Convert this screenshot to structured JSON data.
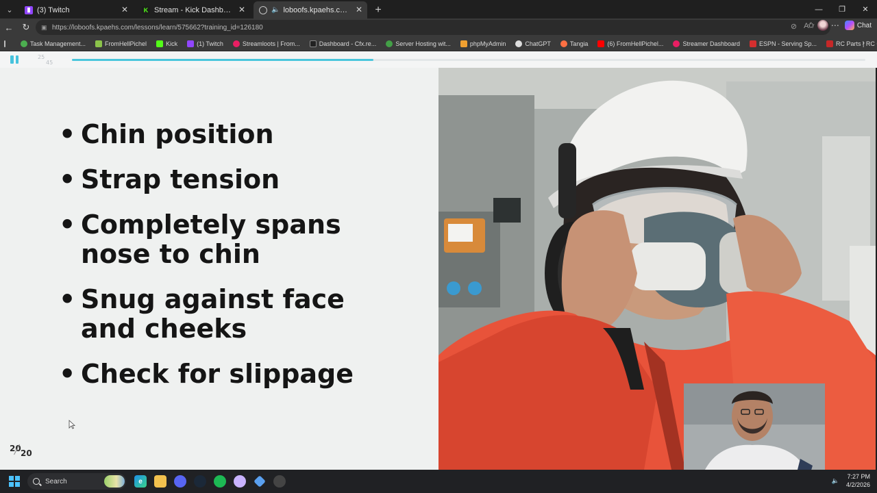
{
  "browser": {
    "tabs": [
      {
        "label": "(3) Twitch",
        "favicon": "twitch-icon",
        "color": "#9146ff",
        "active": false
      },
      {
        "label": "Stream - Kick Dashboard",
        "favicon": "kick-icon",
        "color": "#53fc18",
        "active": false
      },
      {
        "label": "loboofs.kpaehs.com/lessons/l...",
        "favicon": "globe-icon",
        "color": "#9aa0a6",
        "active": true
      }
    ],
    "url": "https://loboofs.kpaehs.com/lessons/learn/575662?training_id=126180",
    "chat_label": "Chat",
    "bookmarks": [
      {
        "label": "Task Management...",
        "color": "#4caf50"
      },
      {
        "label": "FromHellPichel",
        "color": "#8bc34a"
      },
      {
        "label": "Kick",
        "color": "#53fc18"
      },
      {
        "label": "(1) Twitch",
        "color": "#9146ff"
      },
      {
        "label": "Streamloots | From...",
        "color": "#e91e63"
      },
      {
        "label": "Dashboard - Cfx.re...",
        "color": "#222222"
      },
      {
        "label": "Server Hosting wit...",
        "color": "#43a047"
      },
      {
        "label": "phpMyAdmin",
        "color": "#f0a030"
      },
      {
        "label": "ChatGPT",
        "color": "#dddddd"
      },
      {
        "label": "Tangia",
        "color": "#ff7043"
      },
      {
        "label": "(6) FromHellPichel...",
        "color": "#ff0000"
      },
      {
        "label": "Streamer Dashboard",
        "color": "#e91e63"
      },
      {
        "label": "ESPN - Serving Sp...",
        "color": "#d32f2f"
      },
      {
        "label": "RC Parts | RC Car P...",
        "color": "#c62828"
      }
    ]
  },
  "player": {
    "slide_current": "25",
    "slide_total": "45",
    "progress": 0.38,
    "accent_color": "#4ac6dc"
  },
  "slide": {
    "bullets": [
      "Chin position",
      "Strap tension",
      "Completely spans nose to chin",
      "Snug against face and cheeks",
      "Check for slippage"
    ],
    "brand_top": "20",
    "brand_bottom": "20"
  },
  "taskbar": {
    "search_label": "Search",
    "time": "7:27 PM",
    "date": "4/2/2026"
  }
}
